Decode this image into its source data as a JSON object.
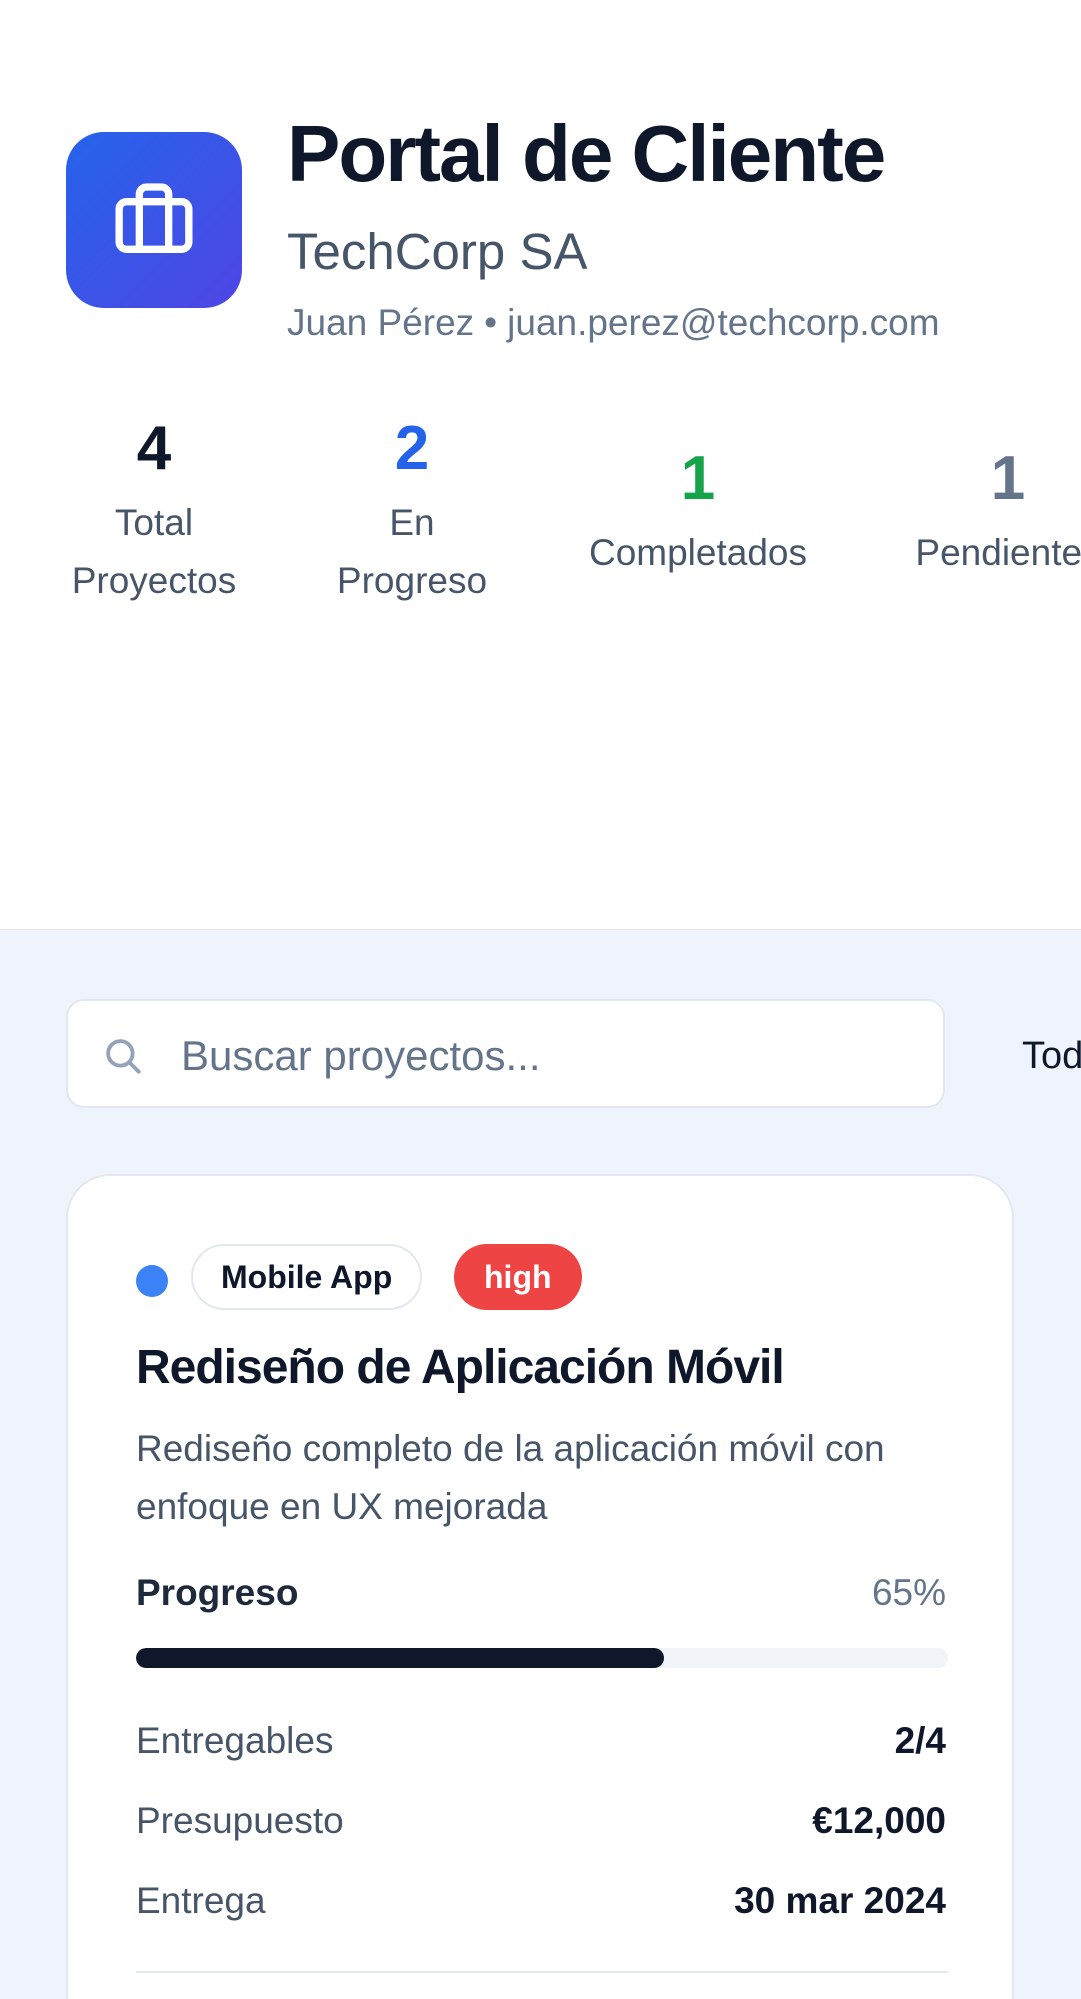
{
  "header": {
    "title": "Portal de Cliente",
    "company": "TechCorp SA",
    "user_name": "Juan Pérez",
    "separator": "•",
    "user_email": "juan.perez@techcorp.com",
    "icon": "briefcase-icon",
    "icon_gradient": [
      "#2563eb",
      "#4f46e5"
    ]
  },
  "stats": {
    "total": {
      "value": "4",
      "label_line1": "Total",
      "label_line2": "Proyectos",
      "color": "#0f172a"
    },
    "in_progress": {
      "value": "2",
      "label_line1": "En",
      "label_line2": "Progreso",
      "color": "#2563eb"
    },
    "completed": {
      "value": "1",
      "label": "Completados",
      "color": "#16a34a"
    },
    "pending": {
      "value": "1",
      "label": "Pendientes",
      "color": "#64748b"
    }
  },
  "search": {
    "placeholder": "Buscar proyectos...",
    "icon": "search-icon"
  },
  "filter": {
    "selected": "Todos"
  },
  "project": {
    "status_color": "#3b82f6",
    "category": "Mobile App",
    "priority": "high",
    "priority_color": "#ef4444",
    "title": "Rediseño de Aplicación Móvil",
    "description": "Rediseño completo de la aplicación móvil con enfoque en UX mejorada",
    "progress_label": "Progreso",
    "progress_value": "65%",
    "progress_fraction": 0.65,
    "deliverables_label": "Entregables",
    "deliverables_value": "2/4",
    "budget_label": "Presupuesto",
    "budget_value": "€12,000",
    "delivery_label": "Entrega",
    "delivery_value": "30 mar 2024"
  }
}
